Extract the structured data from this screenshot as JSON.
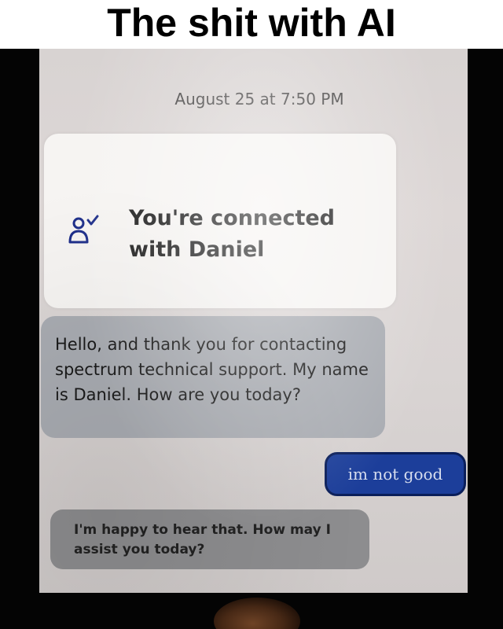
{
  "meme": {
    "caption": "The shit with AI"
  },
  "chat": {
    "timestamp": "August 25 at 7:50 PM",
    "connected_notice": {
      "text": "You're connected with Daniel",
      "icon": "agent-connected-icon"
    },
    "messages": [
      {
        "sender": "agent",
        "text": "Hello, and thank you for contacting spectrum technical support. My name is Daniel. How are you today?"
      },
      {
        "sender": "user",
        "text": "im not good"
      },
      {
        "sender": "agent",
        "text": "I'm happy to hear that. How may I assist you today?"
      }
    ]
  },
  "colors": {
    "caption_bg": "#ffffff",
    "caption_text": "#000000",
    "photo_frame": "#040404",
    "agent_bubble": "#a9acb2",
    "user_bubble": "#1c3e9a",
    "user_text": "#d7ddee"
  }
}
